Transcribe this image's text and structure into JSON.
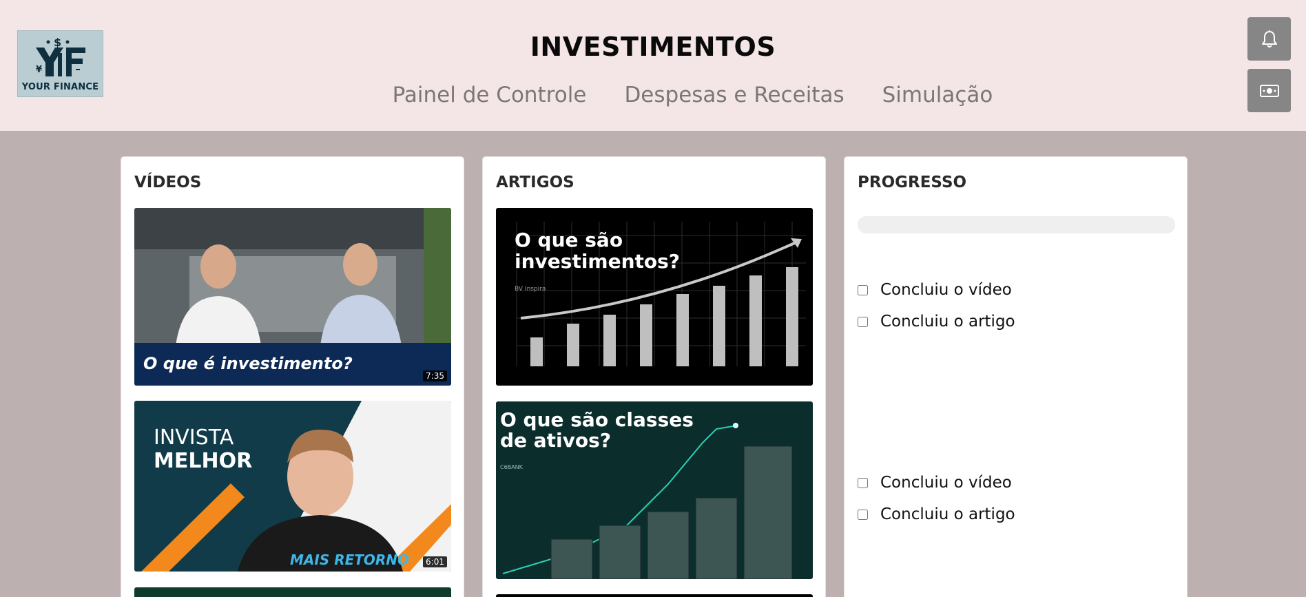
{
  "header": {
    "logo_text": "YOUR FINANCE",
    "title": "INVESTIMENTOS",
    "nav": [
      "Painel de Controle",
      "Despesas e Receitas",
      "Simulação"
    ],
    "bell_icon": "bell-icon",
    "money_icon": "money-icon"
  },
  "videos": {
    "title": "VÍDEOS",
    "items": [
      {
        "caption": "O que é investimento?",
        "duration": "7:35"
      },
      {
        "caption_line1": "INVISTA",
        "caption_line2": "MELHOR",
        "brand": "MAIS RETORNO",
        "duration": "6:01"
      }
    ]
  },
  "articles": {
    "title": "ARTIGOS",
    "items": [
      {
        "line1": "O que são",
        "line2": "investimentos?",
        "source": "BV Inspira"
      },
      {
        "line1": "O que são classes",
        "line2": "de ativos?",
        "source": "C6BANK"
      }
    ]
  },
  "progress": {
    "title": "PROGRESSO",
    "groups": [
      {
        "video_label": "Concluiu o vídeo",
        "article_label": "Concluiu o artigo"
      },
      {
        "video_label": "Concluiu o vídeo",
        "article_label": "Concluiu o artigo"
      }
    ]
  },
  "colors": {
    "header_bg": "#f4e6e6",
    "page_bg": "#bdb0b1",
    "card_bg": "#ffffff",
    "button_bg": "#868686"
  }
}
